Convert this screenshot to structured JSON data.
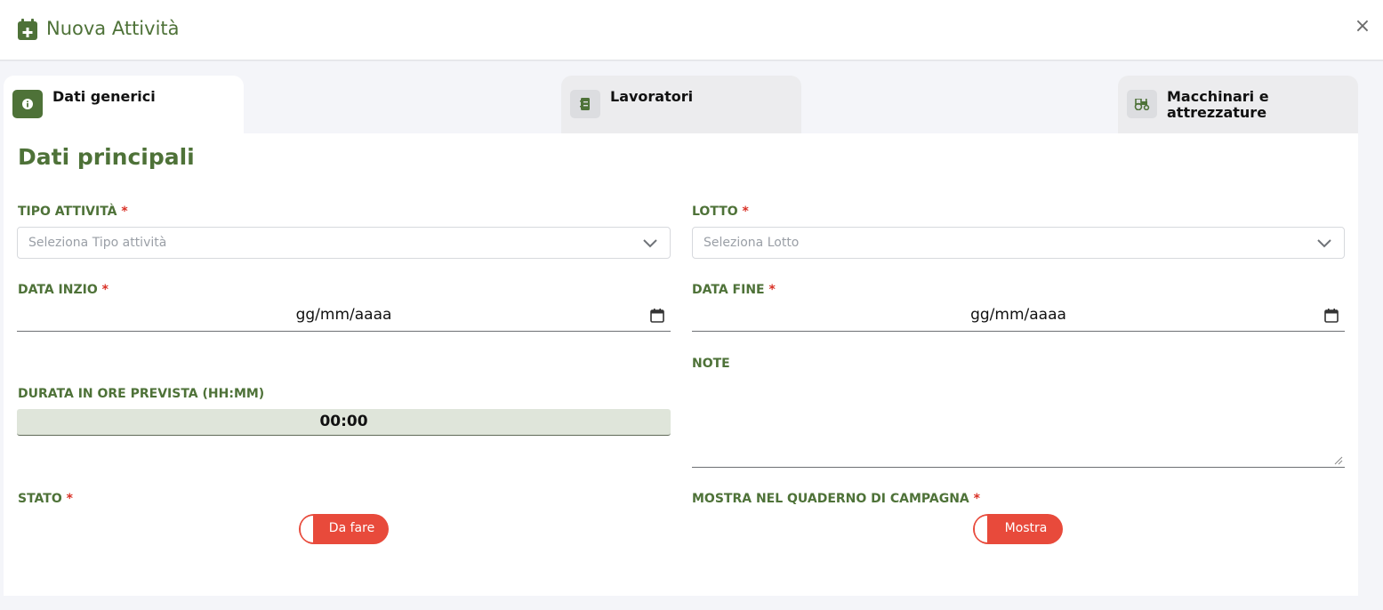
{
  "header": {
    "title": "Nuova Attività",
    "icon": "calendar-plus-icon",
    "close_label": "×"
  },
  "tabs": [
    {
      "label": "Dati generici",
      "icon": "info-icon",
      "active": true
    },
    {
      "label": "Lavoratori",
      "icon": "address-book-icon",
      "active": false
    },
    {
      "label": "Macchinari e attrezzature",
      "icon": "tractor-icon",
      "active": false
    }
  ],
  "section": {
    "title": "Dati principali"
  },
  "form": {
    "required_mark": "*",
    "tipo_attivita": {
      "label": "TIPO ATTIVITÀ",
      "placeholder": "Seleziona Tipo attività"
    },
    "lotto": {
      "label": "LOTTO",
      "placeholder": "Seleziona Lotto"
    },
    "data_inizio": {
      "label": "DATA INZIO",
      "value": "gg/mm/aaaa"
    },
    "data_fine": {
      "label": "DATA FINE",
      "value": "gg/mm/aaaa"
    },
    "note": {
      "label": "NOTE",
      "value": ""
    },
    "durata": {
      "label": "DURATA IN ORE PREVISTA (HH:MM)",
      "value": "00:00"
    },
    "stato": {
      "label": "STATO",
      "toggle_label": "Da fare"
    },
    "mostra": {
      "label": "MOSTRA NEL QUADERNO DI CAMPAGNA",
      "toggle_label": "Mostra"
    }
  },
  "colors": {
    "brand_green": "#4e7238",
    "required_red": "#d93025",
    "toggle_red": "#e84a3b",
    "duration_bg": "#dfe5da"
  }
}
